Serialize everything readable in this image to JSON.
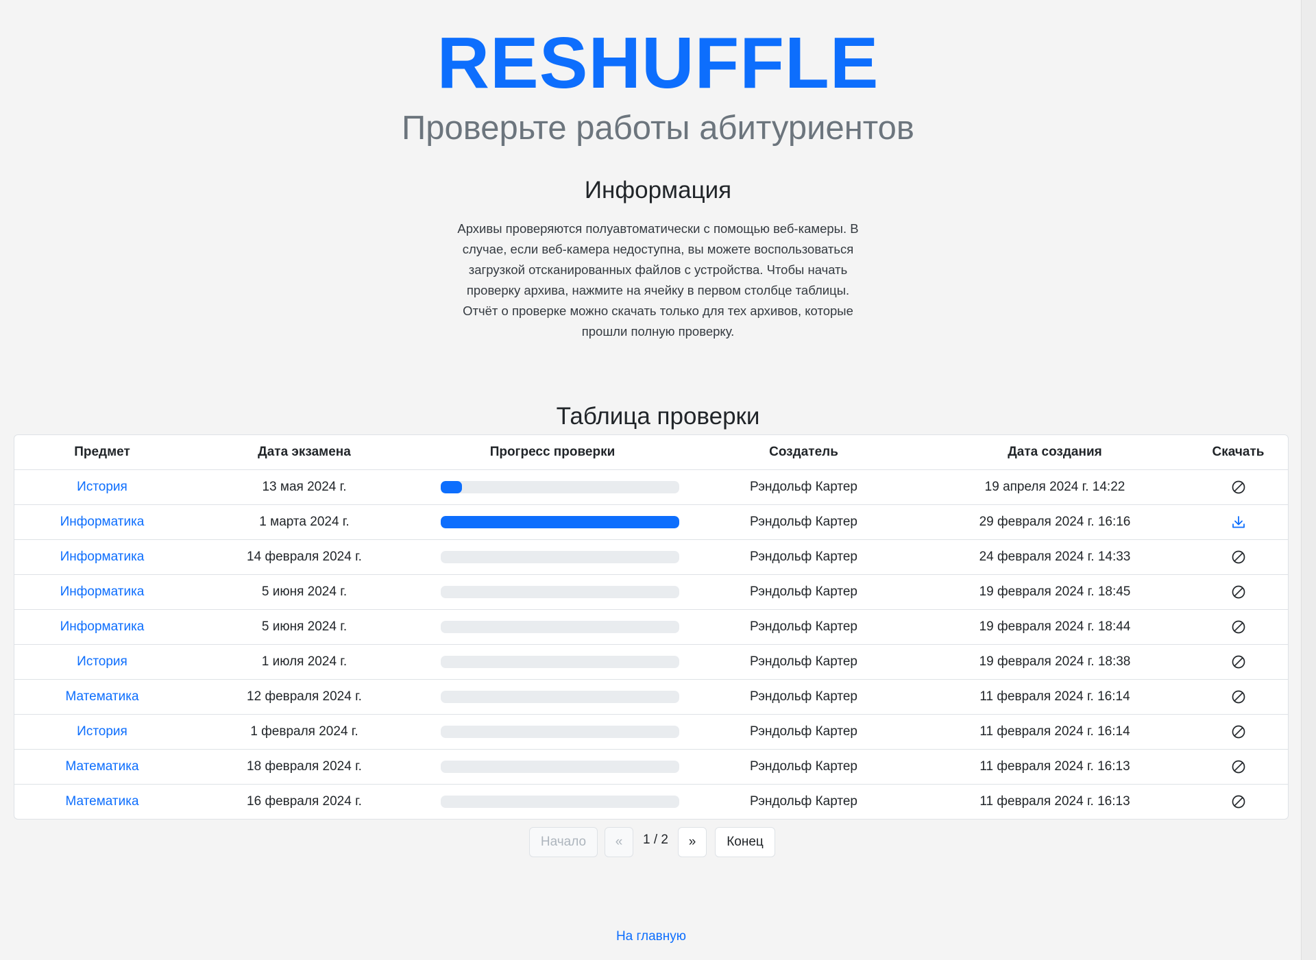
{
  "header": {
    "brand": "RESHUFFLE",
    "subtitle": "Проверьте работы абитуриентов"
  },
  "info": {
    "title": "Информация",
    "text": "Архивы проверяются полуавтоматически с помощью веб-камеры. В случае, если веб-камера недоступна, вы можете воспользоваться загрузкой отсканированных файлов с устройства. Чтобы начать проверку архива, нажмите на ячейку в первом столбце таблицы. Отчёт о проверке можно скачать только для тех архивов, которые прошли полную проверку."
  },
  "table": {
    "title": "Таблица проверки",
    "columns": [
      "Предмет",
      "Дата экзамена",
      "Прогресс проверки",
      "Создатель",
      "Дата создания",
      "Скачать"
    ],
    "rows": [
      {
        "subject": "История",
        "exam_date": "13 мая 2024 г.",
        "progress": 0.09,
        "creator": "Рэндольф Картер",
        "created": "19 апреля 2024 г. 14:22",
        "download": "disabled-icon"
      },
      {
        "subject": "Информатика",
        "exam_date": "1 марта 2024 г.",
        "progress": 1.0,
        "creator": "Рэндольф Картер",
        "created": "29 февраля 2024 г. 16:16",
        "download": "download-icon"
      },
      {
        "subject": "Информатика",
        "exam_date": "14 февраля 2024 г.",
        "progress": 0,
        "creator": "Рэндольф Картер",
        "created": "24 февраля 2024 г. 14:33",
        "download": "disabled-icon"
      },
      {
        "subject": "Информатика",
        "exam_date": "5 июня 2024 г.",
        "progress": 0,
        "creator": "Рэндольф Картер",
        "created": "19 февраля 2024 г. 18:45",
        "download": "disabled-icon"
      },
      {
        "subject": "Информатика",
        "exam_date": "5 июня 2024 г.",
        "progress": 0,
        "creator": "Рэндольф Картер",
        "created": "19 февраля 2024 г. 18:44",
        "download": "disabled-icon"
      },
      {
        "subject": "История",
        "exam_date": "1 июля 2024 г.",
        "progress": 0,
        "creator": "Рэндольф Картер",
        "created": "19 февраля 2024 г. 18:38",
        "download": "disabled-icon"
      },
      {
        "subject": "Математика",
        "exam_date": "12 февраля 2024 г.",
        "progress": 0,
        "creator": "Рэндольф Картер",
        "created": "11 февраля 2024 г. 16:14",
        "download": "disabled-icon"
      },
      {
        "subject": "История",
        "exam_date": "1 февраля 2024 г.",
        "progress": 0,
        "creator": "Рэндольф Картер",
        "created": "11 февраля 2024 г. 16:14",
        "download": "disabled-icon"
      },
      {
        "subject": "Математика",
        "exam_date": "18 февраля 2024 г.",
        "progress": 0,
        "creator": "Рэндольф Картер",
        "created": "11 февраля 2024 г. 16:13",
        "download": "disabled-icon"
      },
      {
        "subject": "Математика",
        "exam_date": "16 февраля 2024 г.",
        "progress": 0,
        "creator": "Рэндольф Картер",
        "created": "11 февраля 2024 г. 16:13",
        "download": "disabled-icon"
      }
    ]
  },
  "pagination": {
    "first_label": "Начало",
    "prev_label": "«",
    "page_indicator": "1 / 2",
    "next_label": "»",
    "last_label": "Конец"
  },
  "footer": {
    "home_link": "На главную"
  },
  "colors": {
    "accent": "#0d6efd",
    "background": "#f4f4f4",
    "progress_track": "#e9ecef"
  }
}
